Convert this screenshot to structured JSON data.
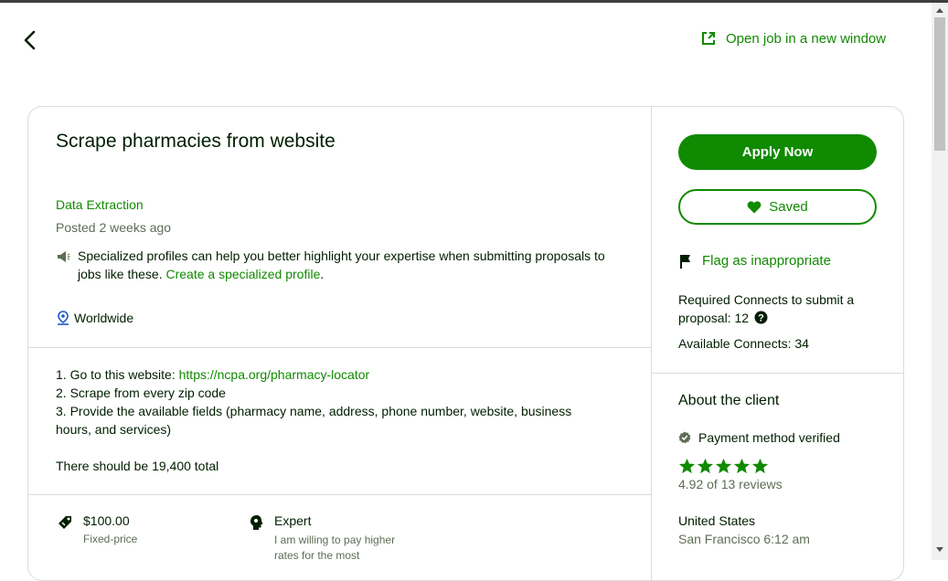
{
  "header": {
    "open_new_label": "Open job in a new window"
  },
  "job": {
    "title": "Scrape pharmacies from website",
    "category": "Data Extraction",
    "posted": "Posted 2 weeks ago",
    "specialized_text": "Specialized profiles can help you better highlight your expertise when submitting proposals to jobs like these. ",
    "specialized_link": "Create a specialized profile",
    "specialized_end": ".",
    "location": "Worldwide",
    "desc_line1_prefix": "1. Go to this website: ",
    "desc_line1_link": "https://ncpa.org/pharmacy-locator",
    "desc_line2": "2. Scrape from every zip code",
    "desc_line3": "3. Provide the available fields (pharmacy name, address, phone number, website, business hours, and services)",
    "desc_total": "There should be 19,400 total",
    "price": "$100.00",
    "price_type": "Fixed-price",
    "level": "Expert",
    "level_desc": "I am willing to pay higher rates for the most"
  },
  "sidebar": {
    "apply_label": "Apply Now",
    "saved_label": "Saved",
    "flag_label": "Flag as inappropriate",
    "connects_text": "Required Connects to submit a proposal: 12",
    "available_connects": "Available Connects: 34"
  },
  "client": {
    "heading": "About the client",
    "payment": "Payment method verified",
    "rating": 4.92,
    "stars_max": 5,
    "reviews": "4.92 of 13 reviews",
    "country": "United States",
    "city_time": "San Francisco 6:12 am"
  },
  "colors": {
    "brand_green": "#108a00",
    "text_dark": "#001e00",
    "text_muted": "#5e6d55"
  }
}
